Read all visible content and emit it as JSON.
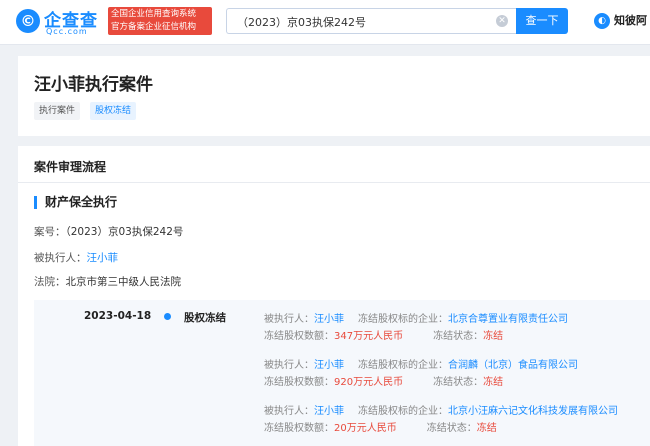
{
  "header": {
    "logo_mark": "©",
    "logo_text": "企查查",
    "logo_sub": "Qcc.com",
    "slogan_line1": "全国企业信用查询系统",
    "slogan_line2": "官方备案企业征信机构",
    "search_value": "（2023）京03执保242号",
    "search_button": "查一下",
    "right_link": "知彼阿"
  },
  "title_card": {
    "title": "汪小菲执行案件",
    "tags": [
      "执行案件",
      "股权冻结"
    ]
  },
  "process": {
    "section_title": "案件审理流程",
    "subsection_title": "财产保全执行",
    "case_no_label": "案号：",
    "case_no_value": "（2023）京03执保242号",
    "executed_label": "被执行人：",
    "executed_value": "汪小菲",
    "court_label": "法院：",
    "court_value": "北京市第三中级人民法院",
    "timeline": {
      "date": "2023-04-18",
      "type": "股权冻结",
      "records": [
        {
          "executed_label": "被执行人：",
          "executed": "汪小菲",
          "company_label": "冻结股权标的企业：",
          "company": "北京合尊置业有限责任公司",
          "amount_label": "冻结股权数额：",
          "amount": "347万元人民币",
          "status_label": "冻结状态：",
          "status": "冻结"
        },
        {
          "executed_label": "被执行人：",
          "executed": "汪小菲",
          "company_label": "冻结股权标的企业：",
          "company": "合润麟（北京）食品有限公司",
          "amount_label": "冻结股权数额：",
          "amount": "920万元人民币",
          "status_label": "冻结状态：",
          "status": "冻结"
        },
        {
          "executed_label": "被执行人：",
          "executed": "汪小菲",
          "company_label": "冻结股权标的企业：",
          "company": "北京小汪麻六记文化科技发展有限公司",
          "amount_label": "冻结股权数额：",
          "amount": "20万元人民币",
          "status_label": "冻结状态：",
          "status": "冻结"
        }
      ]
    }
  },
  "colors": {
    "accent": "#1a8cff",
    "danger": "#e84a3c"
  }
}
